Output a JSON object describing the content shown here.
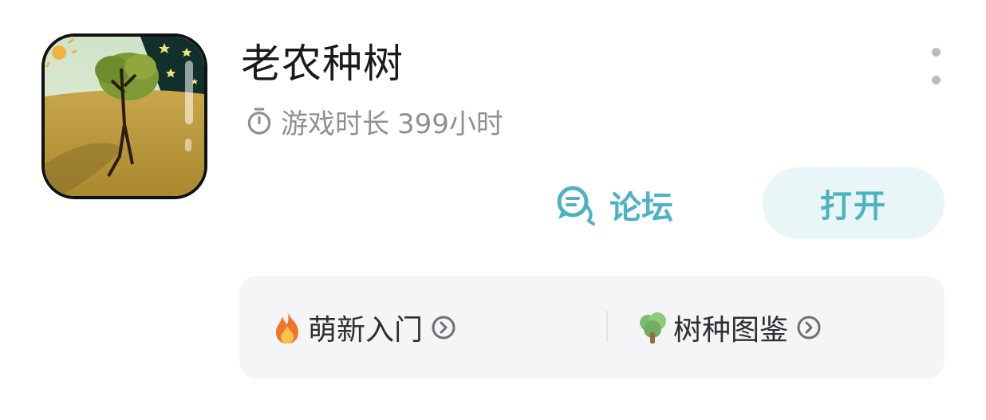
{
  "app": {
    "name": "老农种树",
    "playtime_label": "游戏时长",
    "playtime_value": "399小时"
  },
  "actions": {
    "forum_label": "论坛",
    "open_label": "打开"
  },
  "shortcuts": [
    {
      "label": "萌新入门",
      "icon": "fire-icon"
    },
    {
      "label": "树种图鉴",
      "icon": "tree-icon"
    }
  ],
  "colors": {
    "accent": "#4fb2c2",
    "open_button_bg": "#e9f6f8",
    "panel_bg": "#f4f5f7",
    "muted_text": "#8e9094"
  }
}
